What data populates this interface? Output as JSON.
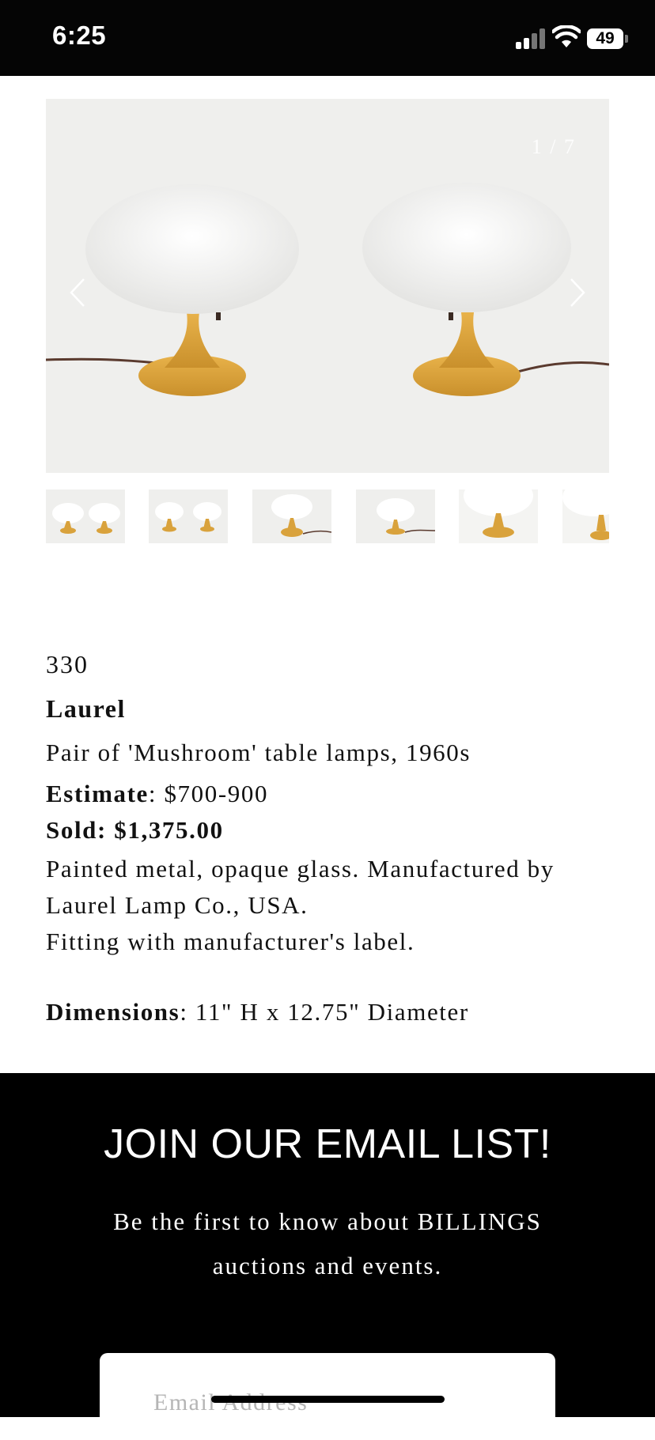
{
  "status_bar": {
    "time": "6:25",
    "battery": "49"
  },
  "gallery": {
    "counter": "1 / 7",
    "thumbnail_count": 6
  },
  "lot": {
    "number": "330",
    "artist": "Laurel",
    "title": "Pair of 'Mushroom' table lamps, 1960s",
    "estimate_label": "Estimate",
    "estimate_value": ": $700-900",
    "sold_label": "Sold",
    "sold_value": ": $1,375.00",
    "description_line1": "Painted metal, opaque glass. Manufactured by",
    "description_line2": "Laurel Lamp Co., USA.",
    "description_line3": "Fitting with manufacturer's label.",
    "dimensions_label": "Dimensions",
    "dimensions_value": ": 11\" H x 12.75\" Diameter"
  },
  "footer": {
    "title": "JOIN OUR EMAIL LIST!",
    "text": "Be the first to know about BILLINGS auctions and events.",
    "email_placeholder": "Email Address"
  }
}
